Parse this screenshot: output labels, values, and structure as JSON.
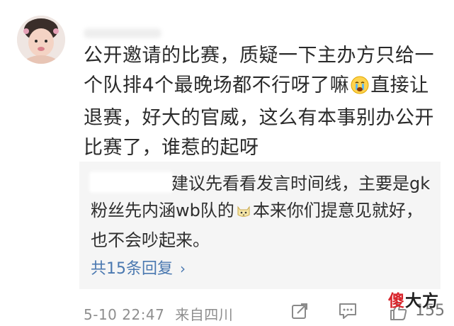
{
  "comment": {
    "text_1": "公开邀请的比赛，质疑一下主办方只给一个队排4个最晚场都不行呀了嘛",
    "text_2": "直接让退赛，好大的官威，这么有本事别办公开比赛了，谁惹的起呀",
    "timestamp": "5-10 22:47",
    "source": "来自四川",
    "like_count": "155"
  },
  "reply": {
    "text_1": "建议先看看发言时间线，主要是gk粉丝先内涵wb队的",
    "text_2": "本来你们提意见就好，也不会吵起来。",
    "more_label": "共15条回复",
    "more_chevron": "›"
  },
  "watermark": {
    "char_1": "傻",
    "char_2": "大方"
  },
  "icons": [
    "share-icon",
    "comment-icon",
    "like-icon",
    "crying-emoji-icon",
    "cat-emoji-icon"
  ],
  "colors": {
    "link_blue": "#4a78b0",
    "reply_bg": "#f5f5f5",
    "meta_gray": "#8e8e8e",
    "watermark_red": "#d8232a"
  }
}
